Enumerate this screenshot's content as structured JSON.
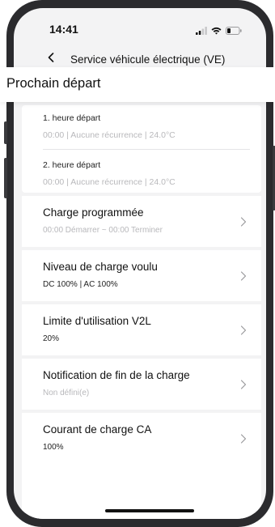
{
  "status_bar": {
    "time": "14:41"
  },
  "header": {
    "title": "Service véhicule électrique (VE)"
  },
  "section": {
    "title": "Prochain départ"
  },
  "departures": [
    {
      "title": "1. heure départ",
      "subtitle": "00:00 | Aucune récurrence | 24.0°C"
    },
    {
      "title": "2. heure départ",
      "subtitle": "00:00 | Aucune récurrence | 24.0°C"
    }
  ],
  "settings": [
    {
      "title": "Charge programmée",
      "subtitle": "00:00 Démarrer ~ 00:00 Terminer",
      "subtitle_style": "gray"
    },
    {
      "title": "Niveau de charge voulu",
      "subtitle": "DC 100% | AC 100%",
      "subtitle_style": "dark"
    },
    {
      "title": "Limite d'utilisation V2L",
      "subtitle": "20%",
      "subtitle_style": "dark"
    },
    {
      "title": "Notification de fin de la charge",
      "subtitle": "Non défini(e)",
      "subtitle_style": "gray"
    },
    {
      "title": "Courant de charge CA",
      "subtitle": "100%",
      "subtitle_style": "dark"
    }
  ],
  "icons": {
    "back": "chevron-left-icon",
    "row_arrow": "chevron-right-icon",
    "signal": "signal-icon",
    "wifi": "wifi-icon",
    "battery": "battery-icon"
  },
  "colors": {
    "background": "#f3f3f4",
    "card": "#ffffff",
    "muted_text": "#b8b8bb",
    "text": "#111111"
  }
}
